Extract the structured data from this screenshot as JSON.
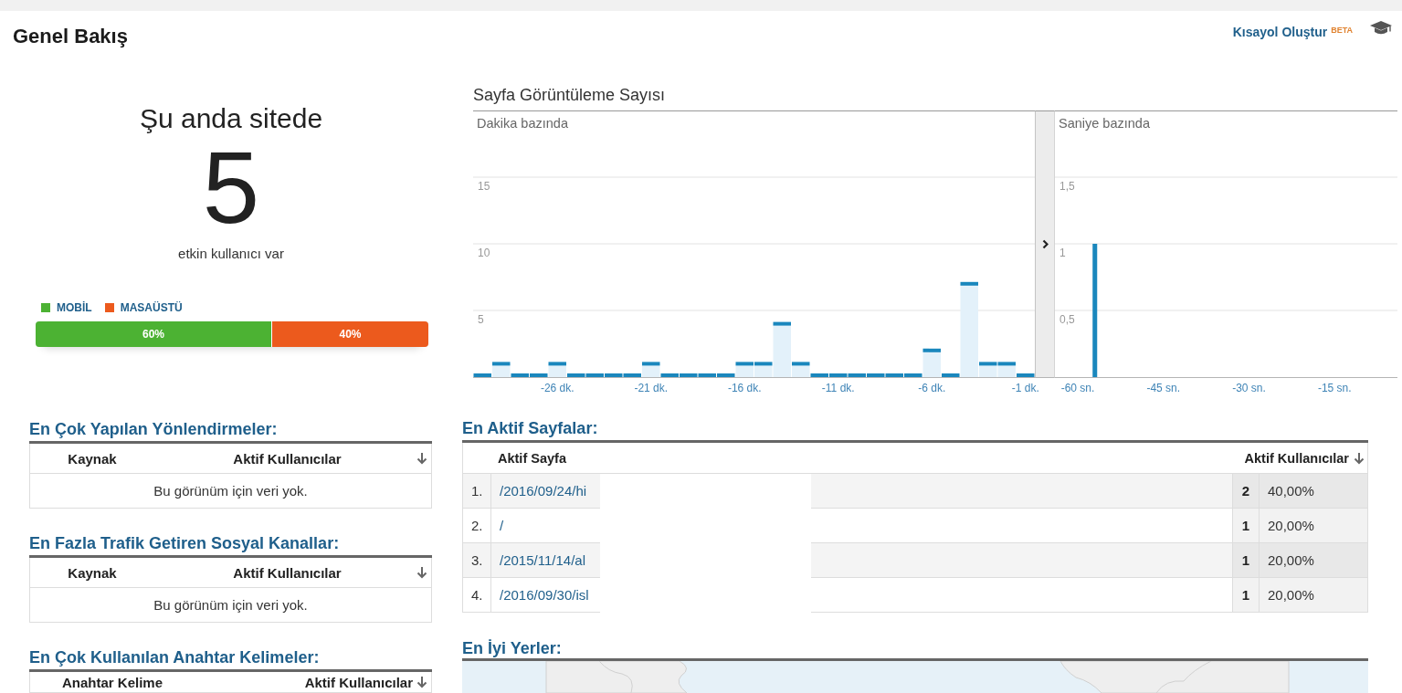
{
  "header": {
    "title": "Genel Bakış",
    "shortcut": {
      "label": "Kısayol Oluştur",
      "badge": "BETA"
    }
  },
  "active_users": {
    "heading": "Şu anda sitede",
    "count": "5",
    "caption": "etkin kullanıcı var",
    "devices": [
      {
        "label": "MOBİL",
        "color": "#4cb233",
        "level": 0.6,
        "share": "60%"
      },
      {
        "label": "MASAÜSTÜ",
        "color": "#ec5a1d",
        "level": 0.4,
        "share": "40%"
      }
    ]
  },
  "pageviews": {
    "title": "Sayfa Görüntüleme Sayısı",
    "per_minute": {
      "chart_data": {
        "type": "bar",
        "title": "Dakika bazında",
        "x": [
          -30,
          -29,
          -28,
          -27,
          -26,
          -25,
          -24,
          -23,
          -22,
          -21,
          -20,
          -19,
          -18,
          -17,
          -16,
          -15,
          -14,
          -13,
          -12,
          -11,
          -10,
          -9,
          -8,
          -7,
          -6,
          -5,
          -4,
          -3,
          -2,
          -1
        ],
        "values": [
          0,
          1,
          0,
          0,
          1,
          0,
          0,
          0,
          0,
          1,
          0,
          0,
          0,
          0,
          1,
          1,
          4,
          1,
          0,
          0,
          0,
          0,
          0,
          0,
          2,
          0,
          7,
          1,
          1,
          0
        ],
        "xlim": [
          -30.5,
          -0.5
        ],
        "ylim": [
          0,
          20
        ],
        "grid": true,
        "yticks": [
          5,
          10,
          15
        ],
        "xticks": [
          {
            "value": -26,
            "label": "-26 dk."
          },
          {
            "value": -21,
            "label": "-21 dk."
          },
          {
            "value": -16,
            "label": "-16 dk."
          },
          {
            "value": -11,
            "label": "-11 dk."
          },
          {
            "value": -6,
            "label": "-6 dk."
          },
          {
            "value": -1,
            "label": "-1 dk."
          }
        ]
      }
    },
    "per_second": {
      "chart_data": {
        "type": "bar",
        "title": "Saniye bazında",
        "x": [
          -57
        ],
        "values": [
          1
        ],
        "xlim": [
          -64,
          -4
        ],
        "ylim": [
          0,
          2
        ],
        "grid": true,
        "yticks": [
          {
            "value": 0.5,
            "label": "0,5"
          },
          {
            "value": 1,
            "label": "1"
          },
          {
            "value": 1.5,
            "label": "1,5"
          }
        ],
        "xticks": [
          {
            "value": -60,
            "label": "-60 sn."
          },
          {
            "value": -45,
            "label": "-45 sn."
          },
          {
            "value": -30,
            "label": "-30 sn."
          },
          {
            "value": -15,
            "label": "-15 sn."
          }
        ]
      }
    }
  },
  "side_tables": [
    {
      "title": "En Çok Yapılan Yönlendirmeler:",
      "columns": [
        {
          "label": "Kaynak",
          "sorted": false
        },
        {
          "label": "Aktif Kullanıcılar",
          "sorted": true
        }
      ],
      "empty_message": "Bu görünüm için veri yok."
    },
    {
      "title": "En Fazla Trafik Getiren Sosyal Kanallar:",
      "columns": [
        {
          "label": "Kaynak",
          "sorted": false
        },
        {
          "label": "Aktif Kullanıcılar",
          "sorted": true
        }
      ],
      "empty_message": "Bu görünüm için veri yok."
    },
    {
      "title": "En Çok Kullanılan Anahtar Kelimeler:",
      "columns": [
        {
          "label": "Anahtar Kelime",
          "sorted": false
        },
        {
          "label": "Aktif Kullanıcılar",
          "sorted": true
        }
      ]
    }
  ],
  "top_pages": {
    "title": "En Aktif Sayfalar:",
    "columns": [
      {
        "label": "Aktif Sayfa",
        "sorted": false
      },
      {
        "label": "Aktif Kullanıcılar",
        "sorted": true
      }
    ],
    "rows": [
      {
        "rank": "1.",
        "page": "/2016/09/24/hi",
        "users": "2",
        "share": "40,00%"
      },
      {
        "rank": "2.",
        "page": "/",
        "users": "1",
        "share": "20,00%"
      },
      {
        "rank": "3.",
        "page": "/2015/11/14/al",
        "users": "1",
        "share": "20,00%"
      },
      {
        "rank": "4.",
        "page": "/2016/09/30/isl",
        "users": "1",
        "share": "20,00%"
      }
    ]
  },
  "top_locations": {
    "title": "En İyi Yerler:"
  }
}
